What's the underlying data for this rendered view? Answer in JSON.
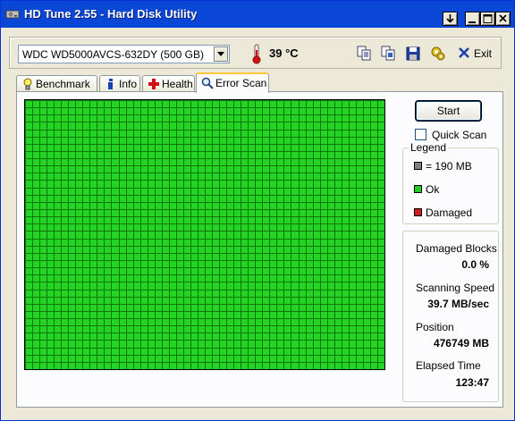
{
  "window": {
    "title": "HD Tune 2.55 - Hard Disk Utility",
    "controls": {
      "help": "?",
      "minimize": "_",
      "maximize": "□",
      "close": "×"
    }
  },
  "toolbar": {
    "drive": "WDC WD5000AVCS-632DY (500 GB)",
    "temperature": "39 °C",
    "exit_label": "Exit",
    "icons": [
      "copy-text-icon",
      "copy-info-icon",
      "save-icon",
      "options-icon",
      "exit-icon"
    ]
  },
  "tabs": [
    {
      "label": "Benchmark",
      "icon": "lightbulb-icon",
      "active": false
    },
    {
      "label": "Info",
      "icon": "info-icon",
      "active": false
    },
    {
      "label": "Health",
      "icon": "health-cross-icon",
      "active": false
    },
    {
      "label": "Error Scan",
      "icon": "magnifier-icon",
      "active": true
    }
  ],
  "scan": {
    "start_label": "Start",
    "quick_scan_label": "Quick Scan",
    "quick_scan_checked": false,
    "block_grid": {
      "columns": 50,
      "rows": 37,
      "status": "ok"
    }
  },
  "legend": {
    "title": "Legend",
    "items": [
      {
        "label": "= 190 MB",
        "color": "#808080"
      },
      {
        "label": "Ok",
        "color": "#22cc22"
      },
      {
        "label": "Damaged",
        "color": "#cc2020"
      }
    ]
  },
  "stats": {
    "damaged_blocks_label": "Damaged Blocks",
    "damaged_blocks_value": "0.0 %",
    "scanning_speed_label": "Scanning Speed",
    "scanning_speed_value": "39.7 MB/sec",
    "position_label": "Position",
    "position_value": "476749 MB",
    "elapsed_label": "Elapsed Time",
    "elapsed_value": "123:47"
  },
  "colors": {
    "ok_block": "#24d324",
    "grid_line": "#0a7a0a",
    "title_bar": "#0a47d6"
  }
}
